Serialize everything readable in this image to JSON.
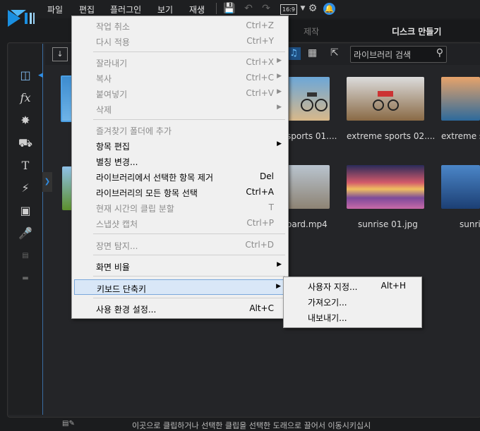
{
  "menubar": {
    "items": [
      "파일",
      "편집",
      "플러그인",
      "보기",
      "재생"
    ],
    "ratio_label": "16:9"
  },
  "tabs": {
    "items": [
      "제작",
      "디스크 만들기"
    ]
  },
  "library": {
    "search_placeholder": "라이브러리 검색",
    "thumbs": [
      {
        "caption": "sports 01...."
      },
      {
        "caption": "extreme sports 02...."
      },
      {
        "caption": "extreme sp"
      },
      {
        "caption": "oard.mp4"
      },
      {
        "caption": "sunrise 01.jpg"
      },
      {
        "caption": "sunris"
      }
    ]
  },
  "edit_menu": {
    "items": [
      {
        "label": "작업 취소",
        "shortcut": "Ctrl+Z",
        "disabled": true
      },
      {
        "label": "다시 적용",
        "shortcut": "Ctrl+Y",
        "disabled": true
      },
      {
        "label": "잘라내기",
        "shortcut": "Ctrl+X",
        "disabled": true
      },
      {
        "label": "복사",
        "shortcut": "Ctrl+C",
        "disabled": true
      },
      {
        "label": "붙여넣기",
        "shortcut": "Ctrl+V",
        "disabled": true
      },
      {
        "label": "삭제",
        "shortcut": "",
        "disabled": true
      },
      {
        "label": "즐겨찾기 폴더에 추가",
        "shortcut": "",
        "disabled": true
      },
      {
        "label": "항목 편집",
        "shortcut": "",
        "disabled": false
      },
      {
        "label": "별칭 변경...",
        "shortcut": "",
        "disabled": false
      },
      {
        "label": "라이브러리에서 선택한 항목 제거",
        "shortcut": "Del",
        "disabled": false
      },
      {
        "label": "라이브러리의 모든 항목 선택",
        "shortcut": "Ctrl+A",
        "disabled": false
      },
      {
        "label": "현재 시간의 클립 분할",
        "shortcut": "T",
        "disabled": true
      },
      {
        "label": "스냅샷 캡처",
        "shortcut": "Ctrl+P",
        "disabled": true
      },
      {
        "label": "장면 탐지...",
        "shortcut": "Ctrl+D",
        "disabled": true
      },
      {
        "label": "화면 비율",
        "shortcut": "",
        "disabled": false
      },
      {
        "label": "키보드 단축키",
        "shortcut": "",
        "disabled": false
      },
      {
        "label": "사용 환경 설정...",
        "shortcut": "Alt+C",
        "disabled": false
      }
    ]
  },
  "shortcut_submenu": {
    "items": [
      {
        "label": "사용자 지정...",
        "shortcut": "Alt+H"
      },
      {
        "label": "가져오기..."
      },
      {
        "label": "내보내기..."
      }
    ]
  },
  "status_bar": {
    "text": "이곳으로 클립하거나 선택한 클립을 선택한 도래으로 끌어서 이동시키십시"
  },
  "colors": {
    "accent": "#2f8de4",
    "menu_bg": "#f0f0f0",
    "highlight": "#d9e7f7"
  }
}
